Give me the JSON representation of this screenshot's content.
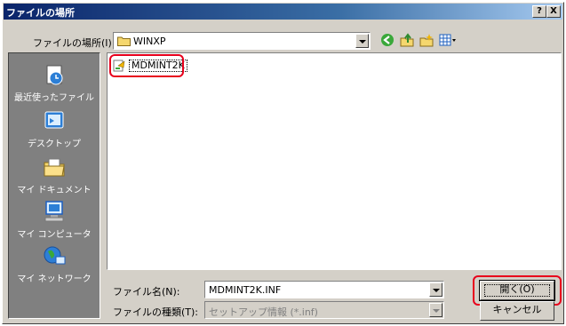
{
  "title": "ファイルの場所",
  "title_buttons": {
    "help": "?",
    "close": "X"
  },
  "lookin": {
    "label": "ファイルの場所(I):",
    "value": "WINXP"
  },
  "toolbar_icons": [
    "back-icon",
    "up-folder-icon",
    "new-folder-icon",
    "view-menu-icon"
  ],
  "places": [
    {
      "label": "最近使ったファイル",
      "icon": "recent-icon"
    },
    {
      "label": "デスクトップ",
      "icon": "desktop-icon"
    },
    {
      "label": "マイ ドキュメント",
      "icon": "my-documents-icon"
    },
    {
      "label": "マイ コンピュータ",
      "icon": "my-computer-icon"
    },
    {
      "label": "マイ ネットワーク",
      "icon": "my-network-icon"
    }
  ],
  "files": [
    {
      "name": "MDMINT2K",
      "icon": "setup-info-icon"
    }
  ],
  "filename": {
    "label": "ファイル名(N):",
    "value": "MDMINT2K.INF"
  },
  "filetype": {
    "label": "ファイルの種類(T):",
    "value": "セットアップ情報 (*.inf)"
  },
  "buttons": {
    "open": "開く(O)",
    "cancel": "キャンセル"
  },
  "colors": {
    "highlight": "#e8001c",
    "titlebar_start": "#0a246a",
    "titlebar_end": "#a6caf0"
  }
}
